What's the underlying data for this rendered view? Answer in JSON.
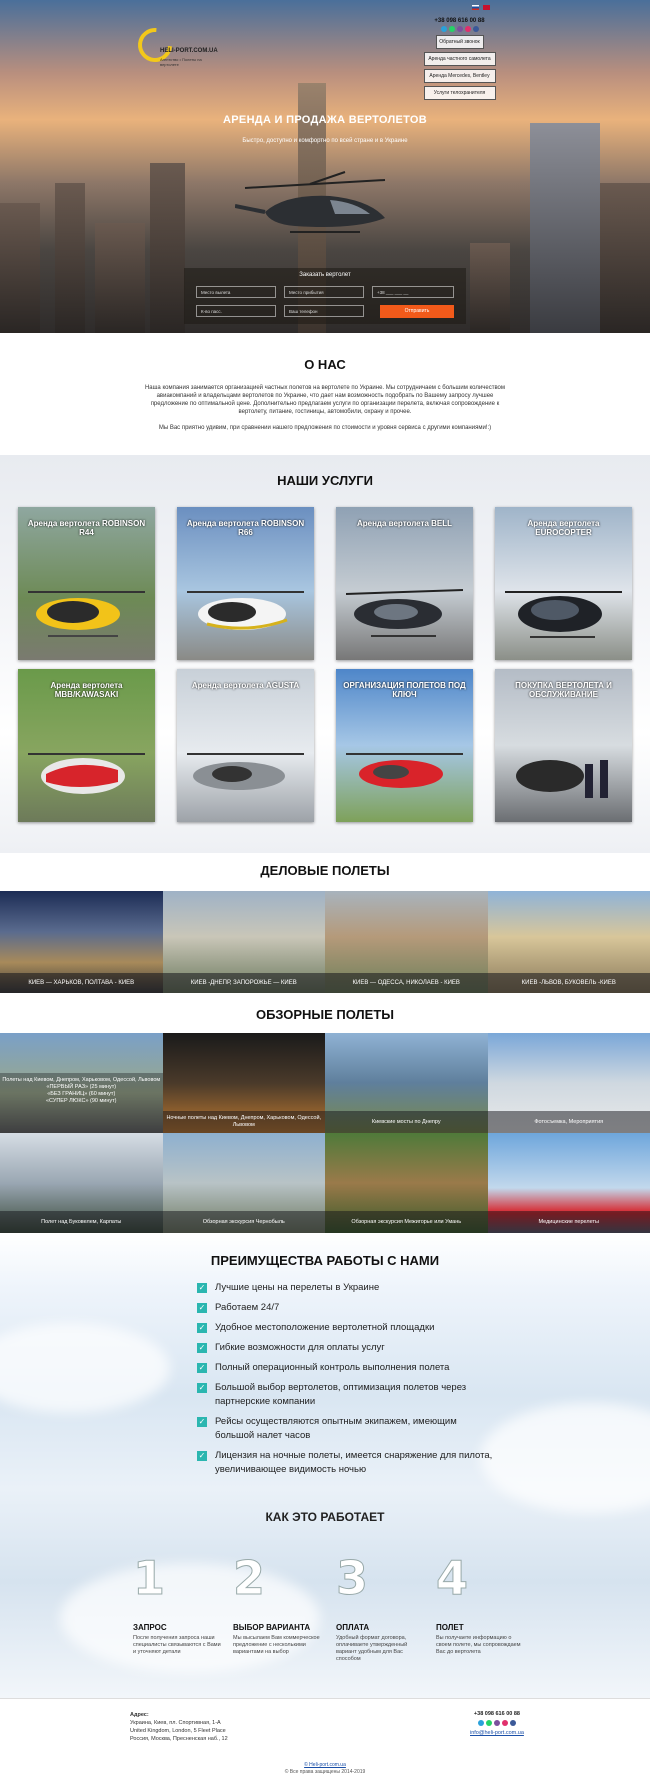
{
  "header": {
    "logo_name": "HELI-PORT.COM.UA",
    "logo_tagline": "Агентство • Полеты на вертолете",
    "phone": "+38 098 616 00 88",
    "buttons": [
      "Обратный звонок",
      "Аренда частного самолета",
      "Аренда Mercedes, Bentley",
      "Услуги телохранителя"
    ]
  },
  "hero": {
    "title": "АРЕНДА И ПРОДАЖА ВЕРТОЛЕТОВ",
    "subtitle": "Быстро, доступно и комфортно по всей стране и в Украине",
    "form_title": "Заказать вертолет",
    "fields": [
      "Место вылета",
      "Место прибытия",
      "+38 ___ ___ __",
      "К-во пасс.",
      "Ваш телефон"
    ],
    "send_label": "Отправить"
  },
  "about": {
    "title": "О НАС",
    "p1": "Наша компания занимается организацией частных полетов на вертолете по Украине. Мы сотрудничаем с большим количеством авиакомпаний и владельцами вертолетов по Украине, что дает нам возможность подобрать по Вашему запросу лучшее предложение по оптимальной цене. Дополнительно предлагаем услуги по организации перелета, включая сопровождение к вертолету, питание, гостиницы, автомобили, охрану и прочее.",
    "p2": "Мы Вас приятно удивим, при сравнении нашего предложения по стоимости и уровня сервиса с другими компаниями!:)"
  },
  "services": {
    "title": "НАШИ УСЛУГИ",
    "cards": [
      "Аренда вертолета ROBINSON R44",
      "Аренда вертолета ROBINSON R66",
      "Аренда вертолета BELL",
      "Аренда вертолета EUROCOPTER",
      "Аренда вертолета MBB/KAWASAKI",
      "Аренда вертолета AGUSTA",
      "ОРГАНИЗАЦИЯ ПОЛЕТОВ ПОД КЛЮЧ",
      "ПОКУПКА ВЕРТОЛЕТА И ОБСЛУЖИВАНИЕ"
    ]
  },
  "business": {
    "title": "ДЕЛОВЫЕ ПОЛЕТЫ",
    "routes": [
      "КИЕВ — ХАРЬКОВ, ПОЛТАВА - КИЕВ",
      "КИЕВ -ДНЕПР, ЗАПОРОЖЬЕ — КИЕВ",
      "КИЕВ — ОДЕССА, НИКОЛАЕВ - КИЕВ",
      "КИЕВ -ЛЬВОВ, БУКОВЕЛЬ -КИЕВ"
    ]
  },
  "overview": {
    "title": "ОБЗОРНЫЕ ПОЛЕТЫ",
    "first_lines": [
      "Полеты над Киевом, Днепром, Харьковом, Одессой, Львовом",
      "«ПЕРВЫЙ РАЗ» (25 минут)",
      "«БЕЗ ГРАНИЦ» (60 минут)",
      "«СУПЕР ЛЮКС» (90 минут)"
    ],
    "tiles": [
      "Ночные полеты над Киевом, Днепром, Харьковом, Одессой, Львовом",
      "Киевские мосты по Днепру",
      "Фотосъемка, Мероприятия",
      "Полет над Буковелем, Карпаты",
      "Обзорная экскурсия Чернобыль",
      "Обзорная экскурсия Межигорье или Умань",
      "Медицинские перелеты"
    ]
  },
  "advantages": {
    "title": "ПРЕИМУЩЕСТВА РАБОТЫ С НАМИ",
    "items": [
      "Лучшие цены на перелеты в Украине",
      "Работаем 24/7",
      "Удобное местоположение вертолетной площадки",
      "Гибкие возможности для оплаты услуг",
      "Полный операционный контроль выполнения полета",
      "Большой выбор вертолетов, оптимизация полетов через партнерские компании",
      "Рейсы осуществляются опытным экипажем, имеющим большой налет часов",
      "Лицензия на ночные полеты, имеется снаряжение для пилота, увеличивающее видимость ночью"
    ]
  },
  "how": {
    "title": "КАК ЭТО РАБОТАЕТ",
    "steps": [
      {
        "num": "1",
        "title": "ЗАПРОС",
        "desc": "После получения запроса наши специалисты связываются с Вами и уточняют детали"
      },
      {
        "num": "2",
        "title": "ВЫБОР ВАРИАНТА",
        "desc": "Мы высылаем Вам коммерческое предложение с несколькими вариантами на выбор"
      },
      {
        "num": "3",
        "title": "ОПЛАТА",
        "desc": "Удобный формат договора, оплачиваете утвержденный вариант удобным для Вас способом"
      },
      {
        "num": "4",
        "title": "ПОЛЕТ",
        "desc": "Вы получаете информацию о своем полете, мы сопровождаем Вас до вертолета"
      }
    ]
  },
  "footer": {
    "addr_label": "Адрес:",
    "addr_lines": [
      "Украина, Киев, пл. Спортивная, 1-А",
      "United Kingdom, London, 5 Fleet Place",
      "Россия, Москва, Пресненская наб., 12"
    ],
    "phone": "+38 098 616 00 88",
    "email": "info@heli-port.com.ua",
    "site": "© Heli-port.com.ua",
    "rights": "© Все права защищены 2014-2019"
  }
}
